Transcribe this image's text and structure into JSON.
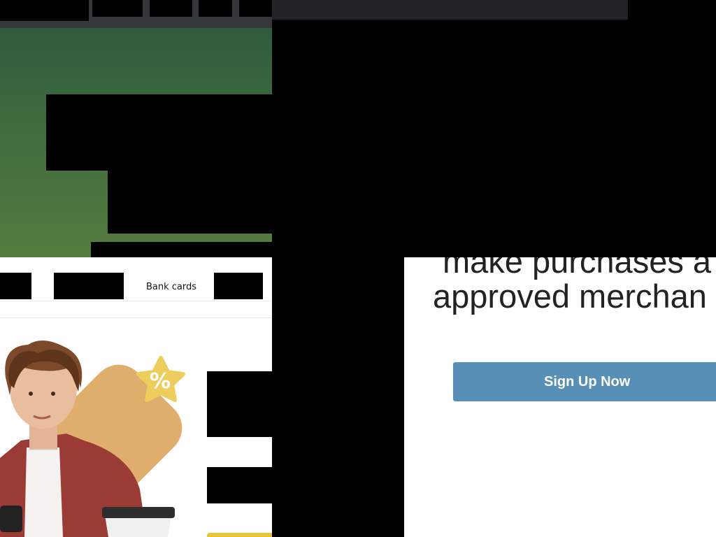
{
  "background_page": {
    "nav": {
      "visible_item": "Bank cards"
    }
  },
  "modal": {
    "headline_line1": "make purchases a",
    "headline_line2": "approved merchan",
    "signup_label": "Sign Up Now"
  },
  "colors": {
    "hero_green_top": "#2f5b3c",
    "hero_green_bottom": "#557c3f",
    "signup_blue": "#578fb7",
    "promo_orange": "#dfae6c",
    "star_yellow": "#edcd5b"
  }
}
